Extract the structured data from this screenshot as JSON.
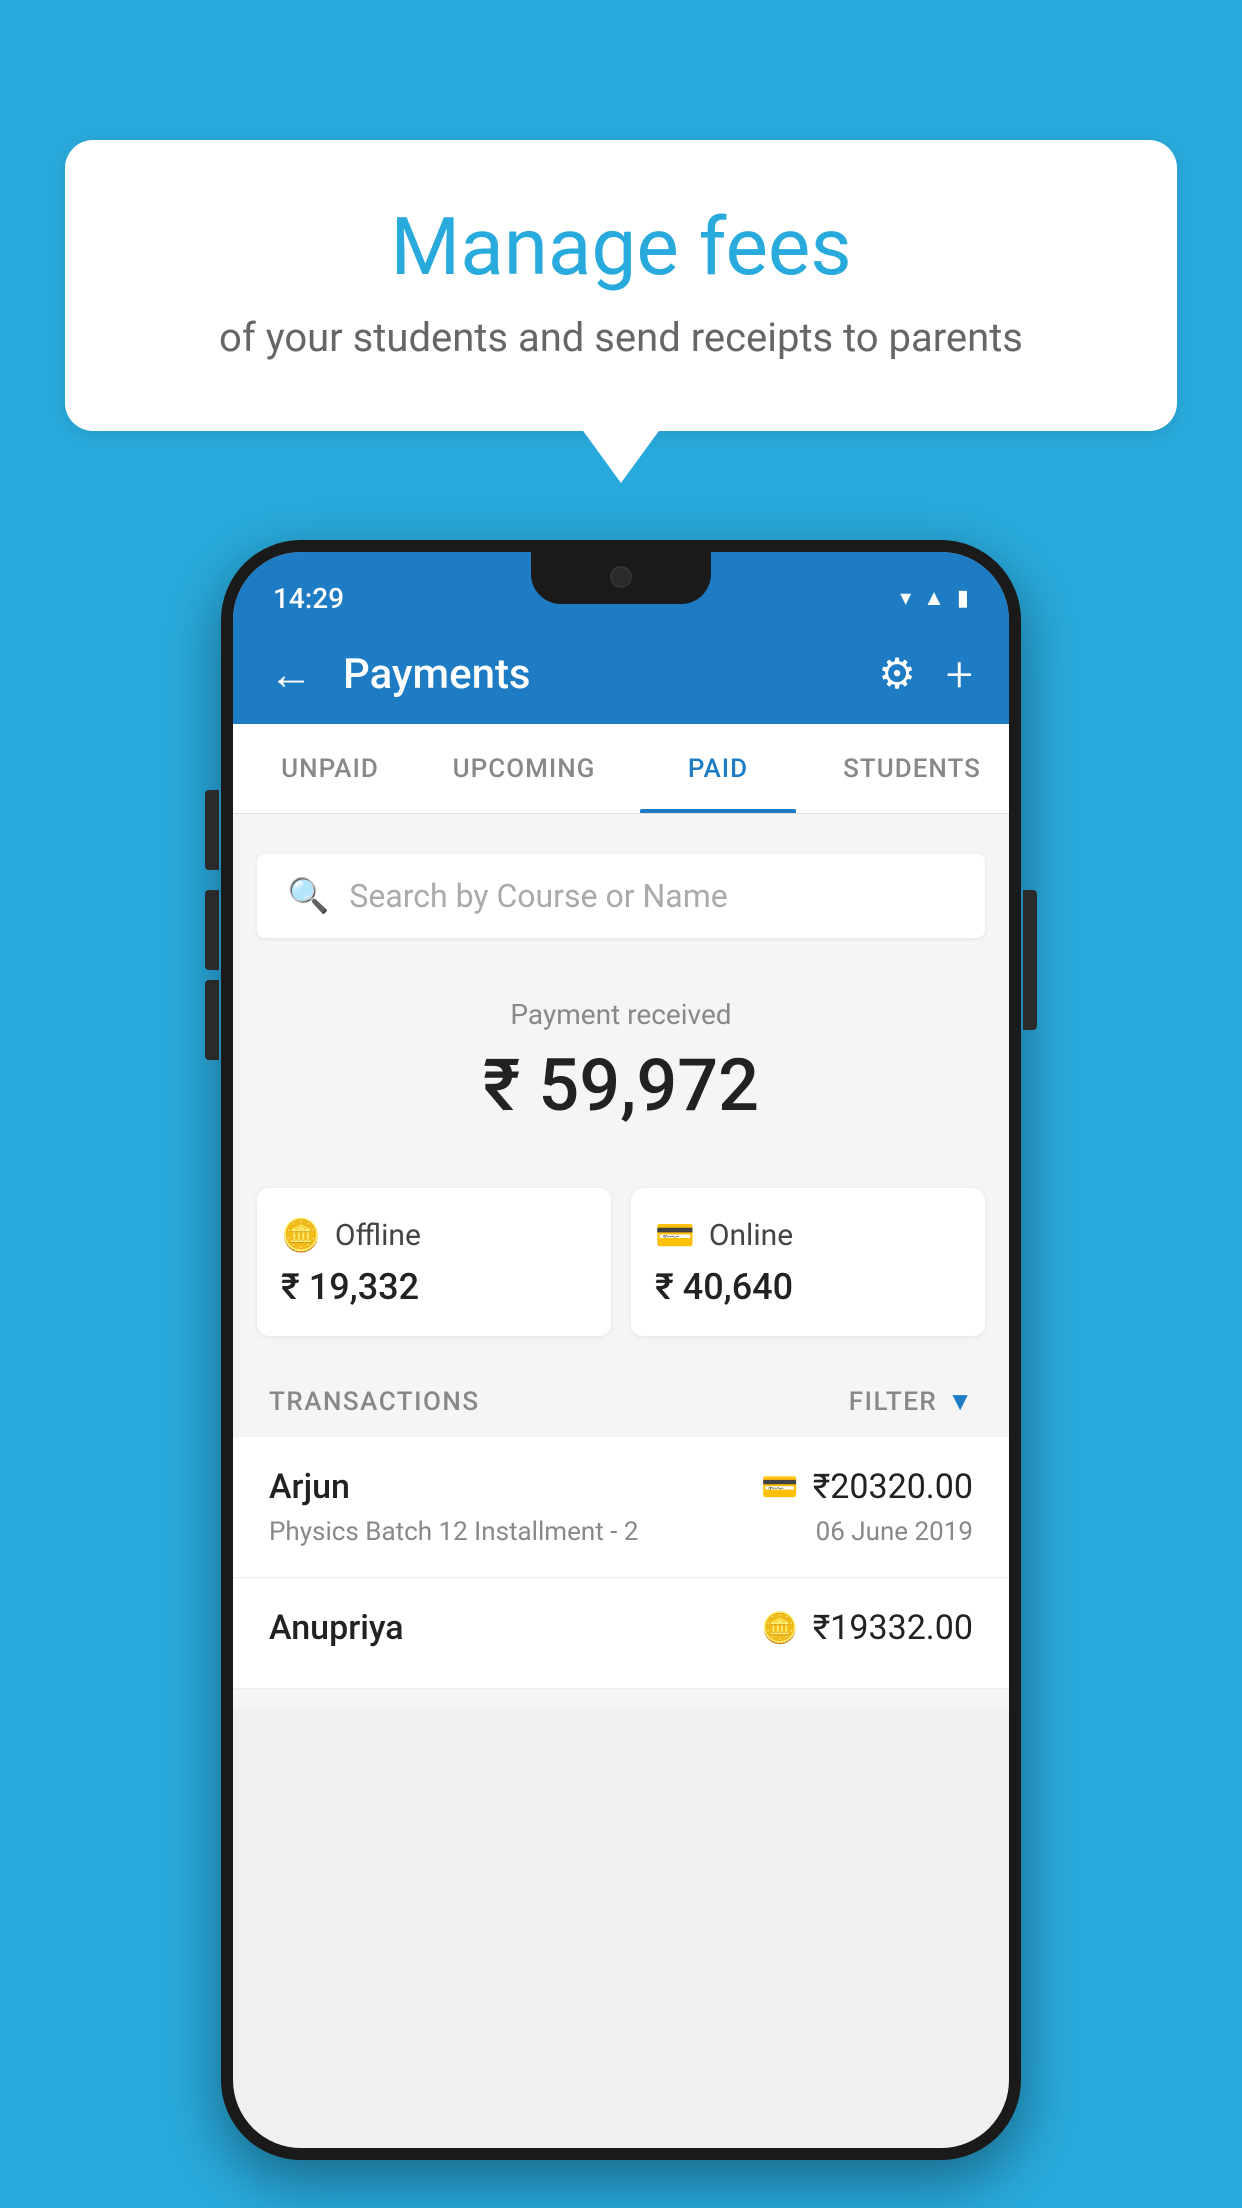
{
  "background_color": "#29AADC",
  "bubble": {
    "title": "Manage fees",
    "subtitle": "of your students and send receipts to parents"
  },
  "status_bar": {
    "time": "14:29",
    "icons": [
      "wifi",
      "signal",
      "battery"
    ]
  },
  "header": {
    "title": "Payments",
    "back_label": "←",
    "gear_label": "⚙",
    "plus_label": "+"
  },
  "tabs": [
    {
      "label": "UNPAID",
      "active": false
    },
    {
      "label": "UPCOMING",
      "active": false
    },
    {
      "label": "PAID",
      "active": true
    },
    {
      "label": "STUDENTS",
      "active": false
    }
  ],
  "search": {
    "placeholder": "Search by Course or Name"
  },
  "payment_received": {
    "label": "Payment received",
    "amount": "₹ 59,972"
  },
  "payment_cards": [
    {
      "icon": "offline",
      "label": "Offline",
      "amount": "₹ 19,332"
    },
    {
      "icon": "online",
      "label": "Online",
      "amount": "₹ 40,640"
    }
  ],
  "transactions_label": "TRANSACTIONS",
  "filter_label": "FILTER",
  "transactions": [
    {
      "name": "Arjun",
      "description": "Physics Batch 12 Installment - 2",
      "date": "06 June 2019",
      "amount": "₹20320.00",
      "payment_type": "online"
    },
    {
      "name": "Anupriya",
      "description": "",
      "date": "",
      "amount": "₹19332.00",
      "payment_type": "offline"
    }
  ]
}
